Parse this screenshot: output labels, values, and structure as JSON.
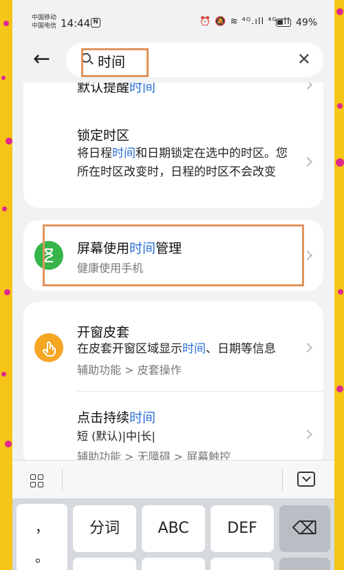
{
  "status_bar": {
    "carrier_1": "中国移动",
    "carrier_2": "中国电信",
    "time": "14:44",
    "nfc": "N",
    "icons": "⏰ 🔕 ≋ ⁴ᴳ.ıll ⁴ᴳ.ıll",
    "battery": "49%"
  },
  "search": {
    "query": "时间",
    "back_icon": "←",
    "clear_icon": "✕"
  },
  "results": {
    "partial_row": {
      "title_prefix": "默认提醒",
      "title_keyword": "时间"
    },
    "lock_timezone": {
      "title": "锁定时区",
      "desc_1": "将日程",
      "desc_kw": "时间",
      "desc_2": "和日期锁定在选中的时区。您所在时区改变时，日程的时区不会改变"
    },
    "screen_time": {
      "title_prefix": "屏幕使用",
      "title_kw": "时间",
      "title_suffix": "管理",
      "subtitle": "健康使用手机",
      "icon": "hourglass-icon",
      "icon_color": "#36b54a"
    },
    "window_cover": {
      "title": "开窗皮套",
      "desc_1": "在皮套开窗区域显示",
      "desc_kw": "时间",
      "desc_2": "、日期等信息",
      "path": "辅助功能 > 皮套操作",
      "icon": "hand-icon",
      "icon_color": "#f5a623"
    },
    "touch_duration": {
      "title_prefix": "点击持续",
      "title_kw": "时间",
      "desc": "短 (默认)|中|长|",
      "path": "辅助功能 > 无障碍 > 屏幕触控"
    }
  },
  "keyboard": {
    "keys": {
      "punct_1": "，",
      "punct_2": "。",
      "fenci": "分词",
      "abc": "ABC",
      "def": "DEF",
      "backspace": "⌫"
    }
  },
  "colors": {
    "keyword": "#2a6fd6",
    "annotation_box": "#e0935a"
  }
}
